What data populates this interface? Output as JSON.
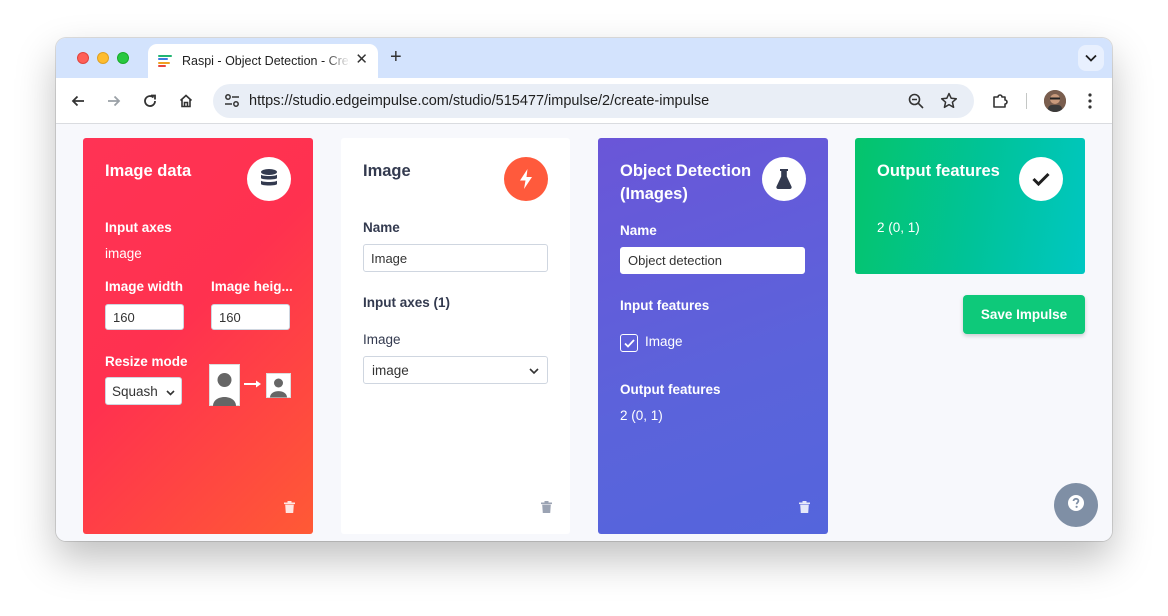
{
  "browser": {
    "tab_title": "Raspi - Object Detection - Create impulse",
    "url": "https://studio.edgeimpulse.com/studio/515477/impulse/2/create-impulse"
  },
  "image_data_block": {
    "title": "Image data",
    "input_axes_label": "Input axes",
    "input_axes_value": "image",
    "width_label": "Image width",
    "width_value": "160",
    "height_label": "Image heig...",
    "height_value": "160",
    "resize_label": "Resize mode",
    "resize_value": "Squash"
  },
  "processing_block": {
    "title": "Image",
    "name_label": "Name",
    "name_value": "Image",
    "input_axes_label": "Input axes (1)",
    "axis_label": "Image",
    "axis_value": "image"
  },
  "learning_block": {
    "title": "Object Detection (Images)",
    "name_label": "Name",
    "name_value": "Object detection",
    "input_features_label": "Input features",
    "input_feature_item": "Image",
    "output_features_label": "Output features",
    "output_features_value": "2 (0, 1)"
  },
  "output_block": {
    "title": "Output features",
    "value": "2 (0, 1)"
  },
  "actions": {
    "save_label": "Save Impulse"
  },
  "colors": {
    "image_data": "#ff3355",
    "processing_icon": "#ff5a3c",
    "learning": "#6a56d8",
    "output": "#05c46b",
    "save": "#0ec97a"
  },
  "icons": {
    "image_data": "database-icon",
    "processing": "bolt-icon",
    "learning": "flask-icon",
    "output": "check-icon",
    "help": "question-icon"
  }
}
